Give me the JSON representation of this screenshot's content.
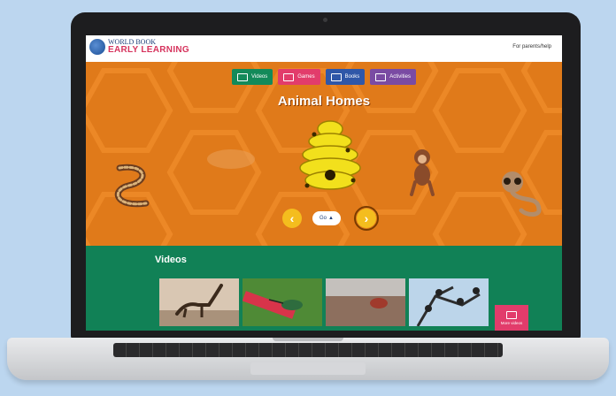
{
  "header": {
    "logo_top": "WORLD BOOK",
    "logo_bottom": "EARLY LEARNING",
    "for_parents": "For parents/help"
  },
  "tabs": [
    {
      "label": "Videos",
      "color": "#138a5a",
      "icon": "video-icon"
    },
    {
      "label": "Games",
      "color": "#e23c6b",
      "icon": "gamepad-icon"
    },
    {
      "label": "Books",
      "color": "#2f57a8",
      "icon": "book-icon"
    },
    {
      "label": "Activities",
      "color": "#7a4ba3",
      "icon": "activities-icon"
    }
  ],
  "hero": {
    "title": "Animal Homes",
    "audio_label": "Go",
    "background_color": "#e07a1a",
    "prev_icon": "chevron-left-icon",
    "next_icon": "chevron-right-icon"
  },
  "videos": {
    "title": "Videos",
    "more_label": "More videos",
    "items": [
      {
        "icon": "dinosaur-thumbnail"
      },
      {
        "icon": "hummingbird-thumbnail"
      },
      {
        "icon": "bird-thumbnail"
      },
      {
        "icon": "birds-on-branch-thumbnail"
      }
    ]
  }
}
